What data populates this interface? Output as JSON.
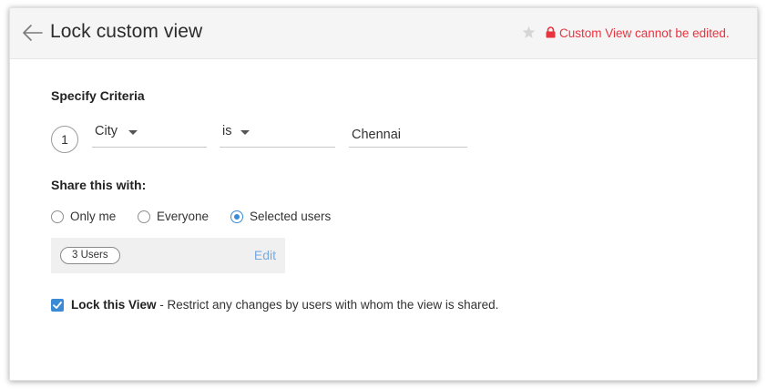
{
  "header": {
    "title": "Lock custom view",
    "lock_message": "Custom View cannot be edited.",
    "icons": [
      "back-arrow-icon",
      "star-icon",
      "lock-icon"
    ],
    "lock_message_color": "#e8343f"
  },
  "criteria": {
    "section_title": "Specify Criteria",
    "rows": [
      {
        "number": "1",
        "field": "City",
        "operator": "is",
        "value": "Chennai"
      }
    ]
  },
  "share": {
    "section_title": "Share this with:",
    "options": [
      {
        "label": "Only me",
        "selected": false
      },
      {
        "label": "Everyone",
        "selected": false
      },
      {
        "label": "Selected users",
        "selected": true
      }
    ],
    "users_pill": "3 Users",
    "edit_label": "Edit"
  },
  "lock_view": {
    "checked": true,
    "label": "Lock this View",
    "description": " - Restrict any changes by users with whom the view is shared."
  },
  "colors": {
    "accent": "#3a8ad6",
    "link": "#7aa9dc",
    "error": "#e8343f"
  }
}
